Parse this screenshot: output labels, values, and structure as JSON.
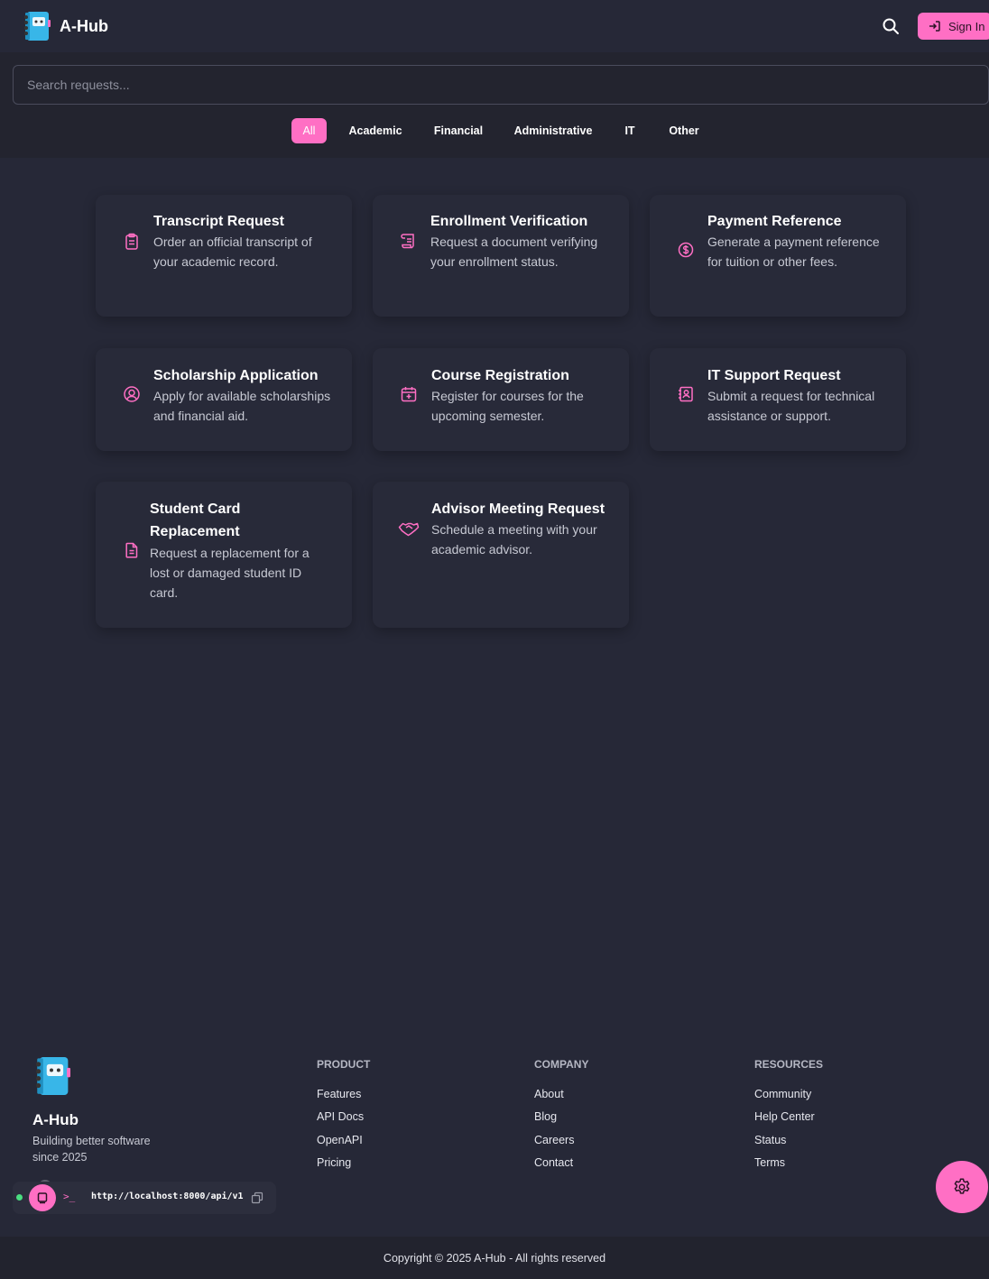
{
  "app": {
    "title": "A-Hub"
  },
  "header": {
    "signin_label": "Sign In",
    "search_icon": "search-icon"
  },
  "search": {
    "placeholder": "Search requests..."
  },
  "tabs": [
    {
      "label": "All",
      "active": true
    },
    {
      "label": "Academic",
      "active": false
    },
    {
      "label": "Financial",
      "active": false
    },
    {
      "label": "Administrative",
      "active": false
    },
    {
      "label": "IT",
      "active": false
    },
    {
      "label": "Other",
      "active": false
    }
  ],
  "cards": [
    {
      "title": "Transcript Request",
      "desc": "Order an official transcript of your academic record.",
      "icon": "clipboard-icon"
    },
    {
      "title": "Enrollment Verification",
      "desc": "Request a document verifying your enrollment status.",
      "icon": "scroll-icon"
    },
    {
      "title": "Payment Reference",
      "desc": "Generate a payment reference for tuition or other fees.",
      "icon": "dollar-coin-icon"
    },
    {
      "title": "Scholarship Application",
      "desc": "Apply for available scholarships and financial aid.",
      "icon": "user-circle-icon"
    },
    {
      "title": "Course Registration",
      "desc": "Register for courses for the upcoming semester.",
      "icon": "calendar-plus-icon"
    },
    {
      "title": "IT Support Request",
      "desc": "Submit a request for technical assistance or support.",
      "icon": "contact-book-icon"
    },
    {
      "title": "Student Card Replacement",
      "desc": "Request a replacement for a lost or damaged student ID card.",
      "icon": "file-icon"
    },
    {
      "title": "Advisor Meeting Request",
      "desc": "Schedule a meeting with your academic advisor.",
      "icon": "handshake-icon"
    }
  ],
  "footer": {
    "brand": "A-Hub",
    "tagline": "Building better software since 2025",
    "columns": [
      {
        "title": "PRODUCT",
        "links": [
          "Features",
          "API Docs",
          "OpenAPI",
          "Pricing"
        ]
      },
      {
        "title": "COMPANY",
        "links": [
          "About",
          "Blog",
          "Careers",
          "Contact"
        ]
      },
      {
        "title": "RESOURCES",
        "links": [
          "Community",
          "Help Center",
          "Status",
          "Terms"
        ]
      }
    ],
    "api": {
      "prompt": ">_",
      "url": "http://localhost:8000/api/v1"
    },
    "copyright": "Copyright © 2025 A-Hub - All rights reserved"
  },
  "colors": {
    "accent": "#ff6fc4",
    "background": "#262837",
    "card": "#282a39",
    "status_online": "#4ade80"
  }
}
